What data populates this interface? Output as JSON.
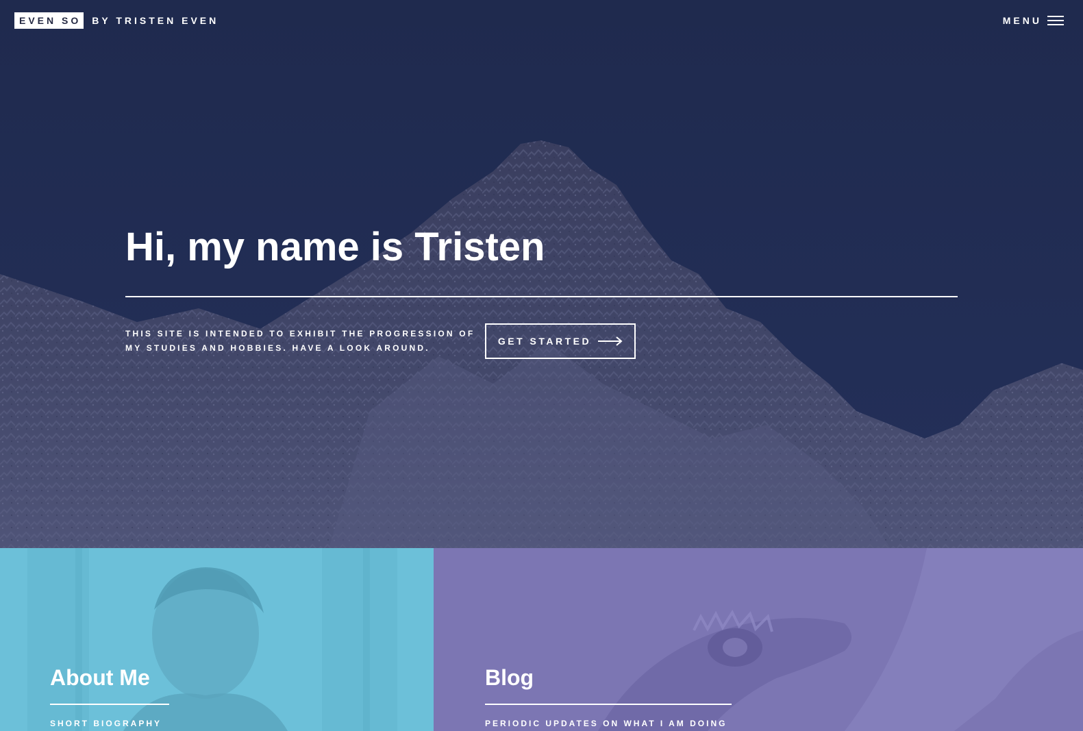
{
  "header": {
    "logo_box": "EVEN SO",
    "logo_by": "BY TRISTEN EVEN",
    "menu_label": "MENU"
  },
  "hero": {
    "title": "Hi, my name is Tristen",
    "description": "THIS SITE IS INTENDED TO EXHIBIT THE PROGRESSION OF MY STUDIES AND HOBBIES. HAVE A LOOK AROUND.",
    "button_label": "GET STARTED"
  },
  "tiles": [
    {
      "title": "About Me",
      "subtitle": "SHORT BIOGRAPHY",
      "color": "#6cc0d9"
    },
    {
      "title": "Blog",
      "subtitle": "PERIODIC UPDATES ON WHAT I AM DOING",
      "color": "#7c76b3"
    }
  ],
  "icons": {
    "menu": "hamburger-icon",
    "button": "arrow-right-icon"
  },
  "colors": {
    "hero_overlay": "#20294d",
    "text": "#ffffff"
  }
}
